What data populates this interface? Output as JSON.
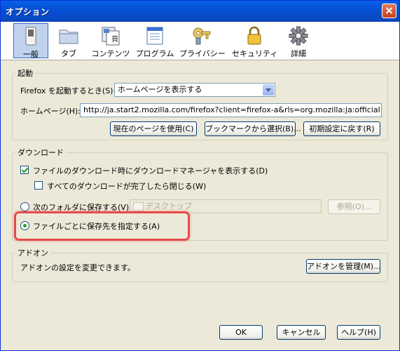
{
  "window": {
    "title": "オプション"
  },
  "toolbar": {
    "items": [
      {
        "label": "一般",
        "icon": "general-switch-icon",
        "selected": true
      },
      {
        "label": "タブ",
        "icon": "folder-tab-icon"
      },
      {
        "label": "コンテンツ",
        "icon": "content-pages-icon"
      },
      {
        "label": "プログラム",
        "icon": "application-window-icon"
      },
      {
        "label": "プライバシー",
        "icon": "key-icon"
      },
      {
        "label": "セキュリティ",
        "icon": "padlock-icon"
      },
      {
        "label": "詳細",
        "icon": "gear-icon"
      }
    ]
  },
  "startup": {
    "group_label": "起動",
    "when_start_label": "Firefox を起動するとき(S):",
    "when_start_value": "ホームページを表示する",
    "homepage_label": "ホームページ(H):",
    "homepage_value": "http://ja.start2.mozilla.com/firefox?client=firefox-a&rls=org.mozilla:ja:official",
    "buttons": {
      "use_current": "現在のページを使用(C)",
      "use_bookmark": "ブックマークから選択(B)...",
      "restore_default": "初期設定に戻す(R)"
    }
  },
  "downloads": {
    "group_label": "ダウンロード",
    "show_manager_label": "ファイルのダウンロード時にダウンロードマネージャを表示する(D)",
    "show_manager_checked": true,
    "close_when_done_label": "すべてのダウンロードが完了したら閉じる(W)",
    "close_when_done_checked": false,
    "save_to_folder_label": "次のフォルダに保存する(V)",
    "folder_value": "デスクトップ",
    "browse_label": "参照(O)...",
    "always_ask_label": "ファイルごとに保存先を指定する(A)"
  },
  "addons": {
    "group_label": "アドオン",
    "description": "アドオンの設定を変更できます。",
    "manage_label": "アドオンを管理(M)..."
  },
  "footer": {
    "ok_label": "OK",
    "cancel_label": "キャンセル",
    "help_label": "ヘルプ(H)"
  },
  "colors": {
    "title_bar": "#0a5fe8",
    "dialog_bg": "#ece9d8",
    "highlight_annotation": "#e64a4a",
    "selected_tab": "#c1d2ee"
  }
}
